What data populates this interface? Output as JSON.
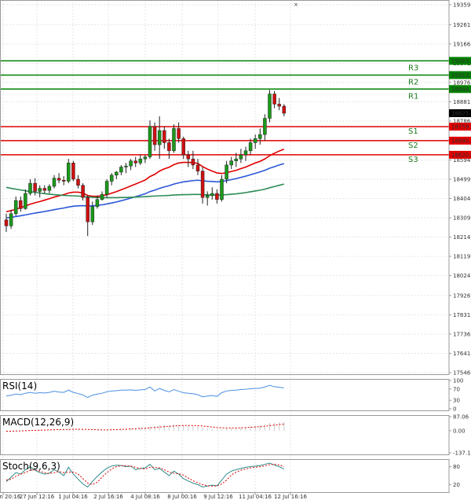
{
  "chart_data": [
    {
      "type": "candlestick",
      "ylim": [
        17546.9,
        19359.8
      ],
      "y_ticks": [
        "19359.8",
        "19261.3",
        "19166.4",
        "19071.5",
        "18976.5",
        "18881.5",
        "18786.3",
        "18691.5",
        "18594.8",
        "18499.8",
        "18404.9",
        "18309.9",
        "18214.9",
        "18119.9",
        "18024.9",
        "17926.9",
        "17831.9",
        "17736.9",
        "17641.9",
        "17546.9"
      ],
      "x_ticks": [
        "26 Jun 20:16",
        "27 Jun 12:16",
        "1 Jul 04:16",
        "2 Jul 16:16",
        "4 Jul 08:16",
        "8 Jul 00:16",
        "9 Jul 12:16",
        "11 Jul 04:16",
        "12 Jul 16:16"
      ],
      "current_price": "18825.4",
      "grid": true,
      "levels": [
        {
          "name": "R3",
          "price": 19083.1,
          "label": "19083.1",
          "color": "#008000"
        },
        {
          "name": "R2",
          "price": 19013.1,
          "label": "19013.1",
          "color": "#008000"
        },
        {
          "name": "R1",
          "price": 18944.3,
          "label": "18944.3",
          "color": "#008000"
        },
        {
          "name": "S1",
          "price": 18759.1,
          "label": "18759.1",
          "color": "#e00000"
        },
        {
          "name": "S2",
          "price": 18690.1,
          "label": "18690.1",
          "color": "#e00000"
        },
        {
          "name": "S3",
          "price": 18620.3,
          "label": "18620.3",
          "color": "#e00000"
        }
      ],
      "candles": [
        [
          18300,
          18330,
          18240,
          18270
        ],
        [
          18270,
          18350,
          18255,
          18330
        ],
        [
          18330,
          18415,
          18320,
          18395
        ],
        [
          18395,
          18415,
          18340,
          18355
        ],
        [
          18355,
          18450,
          18350,
          18430
        ],
        [
          18430,
          18500,
          18420,
          18480
        ],
        [
          18480,
          18505,
          18420,
          18440
        ],
        [
          18440,
          18470,
          18410,
          18455
        ],
        [
          18455,
          18470,
          18430,
          18445
        ],
        [
          18445,
          18475,
          18430,
          18465
        ],
        [
          18465,
          18520,
          18455,
          18505
        ],
        [
          18505,
          18530,
          18480,
          18495
        ],
        [
          18495,
          18515,
          18470,
          18490
        ],
        [
          18490,
          18600,
          18480,
          18580
        ],
        [
          18580,
          18590,
          18490,
          18500
        ],
        [
          18500,
          18520,
          18455,
          18470
        ],
        [
          18470,
          18480,
          18395,
          18410
        ],
        [
          18410,
          18420,
          18220,
          18290
        ],
        [
          18290,
          18390,
          18275,
          18365
        ],
        [
          18365,
          18420,
          18355,
          18400
        ],
        [
          18400,
          18440,
          18395,
          18425
        ],
        [
          18425,
          18500,
          18410,
          18490
        ],
        [
          18490,
          18530,
          18470,
          18520
        ],
        [
          18520,
          18540,
          18500,
          18535
        ],
        [
          18535,
          18570,
          18520,
          18560
        ],
        [
          18560,
          18580,
          18530,
          18565
        ],
        [
          18565,
          18600,
          18545,
          18590
        ],
        [
          18590,
          18610,
          18560,
          18580
        ],
        [
          18580,
          18620,
          18570,
          18600
        ],
        [
          18600,
          18620,
          18580,
          18610
        ],
        [
          18610,
          18790,
          18600,
          18760
        ],
        [
          18760,
          18780,
          18640,
          18670
        ],
        [
          18670,
          18810,
          18600,
          18740
        ],
        [
          18740,
          18760,
          18650,
          18680
        ],
        [
          18680,
          18700,
          18600,
          18640
        ],
        [
          18640,
          18770,
          18630,
          18750
        ],
        [
          18750,
          18780,
          18680,
          18700
        ],
        [
          18700,
          18710,
          18600,
          18620
        ],
        [
          18620,
          18640,
          18560,
          18600
        ],
        [
          18600,
          18640,
          18550,
          18570
        ],
        [
          18570,
          18600,
          18520,
          18540
        ],
        [
          18540,
          18560,
          18380,
          18410
        ],
        [
          18410,
          18440,
          18370,
          18420
        ],
        [
          18420,
          18460,
          18400,
          18430
        ],
        [
          18430,
          18450,
          18380,
          18400
        ],
        [
          18400,
          18520,
          18390,
          18500
        ],
        [
          18500,
          18590,
          18480,
          18570
        ],
        [
          18570,
          18610,
          18550,
          18590
        ],
        [
          18590,
          18630,
          18560,
          18600
        ],
        [
          18600,
          18650,
          18580,
          18620
        ],
        [
          18620,
          18660,
          18590,
          18640
        ],
        [
          18640,
          18700,
          18620,
          18680
        ],
        [
          18680,
          18720,
          18650,
          18700
        ],
        [
          18700,
          18750,
          18670,
          18720
        ],
        [
          18720,
          18820,
          18690,
          18800
        ],
        [
          18800,
          18940,
          18780,
          18920
        ],
        [
          18920,
          18935,
          18850,
          18870
        ],
        [
          18870,
          18900,
          18840,
          18860
        ],
        [
          18860,
          18870,
          18810,
          18825
        ]
      ],
      "series": [
        {
          "name": "",
          "color": "#e00000",
          "values": [
            18340,
            18345,
            18352,
            18360,
            18368,
            18377,
            18384,
            18390,
            18397,
            18404,
            18412,
            18418,
            18424,
            18432,
            18436,
            18436,
            18432,
            18420,
            18416,
            18416,
            18418,
            18424,
            18431,
            18439,
            18448,
            18457,
            18467,
            18476,
            18486,
            18496,
            18513,
            18524,
            18540,
            18551,
            18559,
            18572,
            18580,
            18583,
            18583,
            18582,
            18578,
            18562,
            18550,
            18540,
            18531,
            18528,
            18532,
            18538,
            18544,
            18552,
            18560,
            18570,
            18580,
            18588,
            18600,
            18616,
            18628,
            18639,
            18648
          ]
        },
        {
          "name": "",
          "color": "#2b57d8",
          "values": [
            18310,
            18312,
            18316,
            18320,
            18324,
            18329,
            18333,
            18337,
            18341,
            18345,
            18350,
            18354,
            18358,
            18363,
            18367,
            18369,
            18370,
            18368,
            18369,
            18371,
            18374,
            18378,
            18383,
            18388,
            18394,
            18400,
            18407,
            18414,
            18421,
            18428,
            18439,
            18446,
            18455,
            18462,
            18468,
            18476,
            18482,
            18487,
            18490,
            18493,
            18495,
            18492,
            18490,
            18489,
            18487,
            18489,
            18493,
            18498,
            18503,
            18509,
            18515,
            18522,
            18529,
            18536,
            18544,
            18554,
            18562,
            18570,
            18577
          ]
        },
        {
          "name": "",
          "color": "#2e8b57",
          "values": [
            18460,
            18455,
            18451,
            18447,
            18443,
            18439,
            18435,
            18432,
            18429,
            18426,
            18424,
            18422,
            18420,
            18419,
            18418,
            18417,
            18415,
            18413,
            18411,
            18410,
            18409,
            18409,
            18409,
            18409,
            18410,
            18410,
            18411,
            18412,
            18413,
            18414,
            18416,
            18417,
            18418,
            18419,
            18420,
            18422,
            18423,
            18424,
            18424,
            18425,
            18425,
            18424,
            18423,
            18422,
            18421,
            18422,
            18424,
            18426,
            18428,
            18431,
            18434,
            18438,
            18442,
            18446,
            18451,
            18458,
            18464,
            18470,
            18476
          ]
        }
      ]
    },
    {
      "type": "line",
      "title": "RSI(14)",
      "y_ticks": [
        "100",
        "70",
        "30",
        "0"
      ],
      "ylim": [
        0,
        100
      ],
      "series": [
        {
          "name": "RSI(14)",
          "color": "#4a90e2",
          "values": [
            45,
            48,
            52,
            50,
            55,
            58,
            55,
            57,
            56,
            58,
            62,
            59,
            58,
            66,
            58,
            54,
            49,
            40,
            48,
            52,
            55,
            60,
            63,
            64,
            66,
            66,
            67,
            65,
            67,
            68,
            77,
            63,
            72,
            65,
            60,
            68,
            62,
            57,
            55,
            53,
            50,
            42,
            45,
            47,
            44,
            57,
            63,
            65,
            66,
            68,
            69,
            71,
            72,
            73,
            77,
            83,
            78,
            76,
            74
          ]
        }
      ]
    },
    {
      "type": "bar",
      "title": "MACD(12,26,9)",
      "y_ticks": [
        "87.06",
        "0.00",
        "-137.19"
      ],
      "ylim": [
        -137.19,
        87.06
      ],
      "series": [
        {
          "name": "MACD(12,26,9)",
          "color": "#c8c8c8",
          "values": [
            -2,
            -1,
            1,
            2,
            3,
            5,
            6,
            6,
            7,
            8,
            9,
            9,
            9,
            11,
            11,
            10,
            8,
            3,
            2,
            2,
            3,
            5,
            7,
            9,
            11,
            13,
            15,
            17,
            19,
            21,
            27,
            29,
            33,
            35,
            35,
            38,
            38,
            36,
            33,
            30,
            27,
            20,
            15,
            11,
            8,
            9,
            12,
            15,
            18,
            21,
            24,
            28,
            32,
            35,
            40,
            47,
            50,
            52,
            53
          ]
        },
        {
          "name": "",
          "color": "#e00000",
          "values": [
            -3,
            -3,
            -2,
            -1,
            0,
            1,
            2,
            3,
            4,
            5,
            6,
            7,
            7,
            8,
            9,
            9,
            9,
            8,
            7,
            6,
            5,
            5,
            6,
            7,
            8,
            9,
            11,
            12,
            14,
            15,
            18,
            20,
            23,
            25,
            27,
            29,
            31,
            32,
            32,
            32,
            31,
            29,
            26,
            23,
            20,
            18,
            17,
            17,
            17,
            18,
            19,
            21,
            23,
            25,
            28,
            32,
            35,
            38,
            41
          ]
        }
      ]
    },
    {
      "type": "line",
      "title": "Stoch(9,6,3)",
      "y_ticks": [
        "80",
        "20"
      ],
      "ylim": [
        0,
        100
      ],
      "series": [
        {
          "name": "Stoch(9,6,3)",
          "color": "#2e8b8b",
          "values": [
            30,
            45,
            60,
            55,
            70,
            80,
            68,
            60,
            55,
            58,
            70,
            62,
            50,
            78,
            55,
            38,
            22,
            12,
            30,
            48,
            62,
            75,
            82,
            85,
            84,
            80,
            82,
            70,
            74,
            76,
            88,
            70,
            74,
            62,
            50,
            65,
            55,
            40,
            32,
            25,
            20,
            12,
            15,
            18,
            16,
            35,
            55,
            65,
            70,
            74,
            78,
            80,
            82,
            84,
            88,
            92,
            85,
            80,
            72
          ]
        },
        {
          "name": "",
          "color": "#e00000",
          "values": [
            35,
            38,
            48,
            55,
            60,
            68,
            70,
            65,
            60,
            57,
            60,
            64,
            60,
            62,
            62,
            55,
            40,
            25,
            20,
            28,
            45,
            60,
            72,
            80,
            83,
            83,
            82,
            78,
            74,
            72,
            78,
            78,
            76,
            70,
            62,
            58,
            56,
            52,
            42,
            33,
            26,
            20,
            16,
            15,
            16,
            22,
            35,
            52,
            62,
            68,
            72,
            76,
            78,
            80,
            83,
            87,
            88,
            86,
            80
          ]
        }
      ]
    }
  ]
}
